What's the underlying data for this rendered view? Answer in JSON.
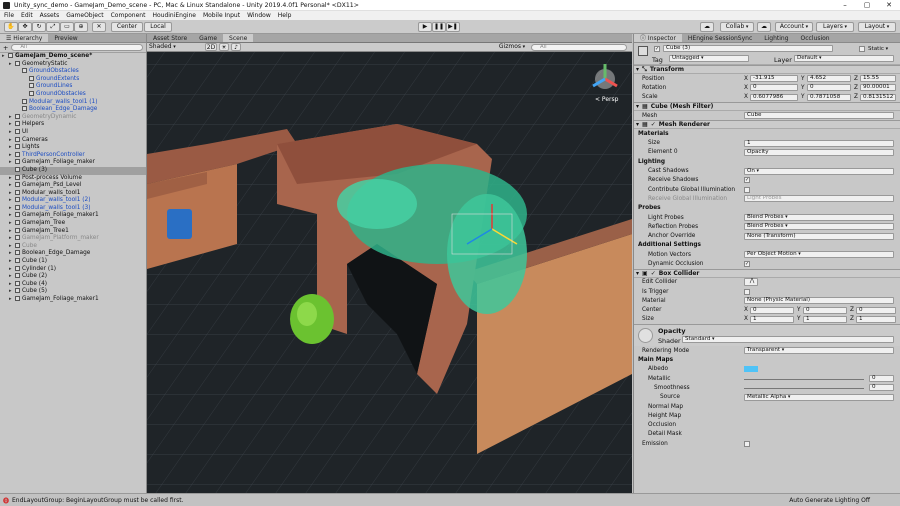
{
  "titlebar": {
    "title": "Unity_sync_demo - GameJam_Demo_scene - PC, Mac & Linux Standalone - Unity 2019.4.0f1 Personal* <DX11>",
    "minimize": "–",
    "maximize": "▢",
    "close": "✕"
  },
  "menu": [
    "File",
    "Edit",
    "Assets",
    "GameObject",
    "Component",
    "HoudiniEngine",
    "Mobile Input",
    "Window",
    "Help"
  ],
  "toolbar": {
    "center": "Center",
    "local": "Local",
    "collab": "Collab",
    "account": "Account",
    "layers": "Layers",
    "layout": "Layout"
  },
  "hierarchy": {
    "tabs": [
      "Hierarchy",
      "Preview"
    ],
    "create": "+",
    "search_placeholder": "All",
    "rows": [
      {
        "text": "GameJam_Demo_scene*",
        "depth": 0,
        "bold": true,
        "color": "",
        "sel": false
      },
      {
        "text": "GeometryStatic",
        "depth": 1,
        "color": "",
        "sel": false
      },
      {
        "text": "GroundObstacles",
        "depth": 2,
        "color": "blue",
        "sel": false
      },
      {
        "text": "GroundExtents",
        "depth": 3,
        "color": "blue",
        "sel": false
      },
      {
        "text": "GroundLines",
        "depth": 3,
        "color": "blue",
        "sel": false
      },
      {
        "text": "GroundObstacles",
        "depth": 3,
        "color": "blue",
        "sel": false
      },
      {
        "text": "Modular_walls_tool1 (1)",
        "depth": 2,
        "color": "blue",
        "sel": false
      },
      {
        "text": "Boolean_Edge_Damage",
        "depth": 2,
        "color": "blue",
        "sel": false
      },
      {
        "text": "GeometryDynamic",
        "depth": 1,
        "color": "gray",
        "sel": false
      },
      {
        "text": "Helpers",
        "depth": 1,
        "color": "",
        "sel": false
      },
      {
        "text": "UI",
        "depth": 1,
        "color": "",
        "sel": false
      },
      {
        "text": "Cameras",
        "depth": 1,
        "color": "",
        "sel": false
      },
      {
        "text": "Lights",
        "depth": 1,
        "color": "",
        "sel": false
      },
      {
        "text": "ThirdPersonController",
        "depth": 1,
        "color": "blue",
        "sel": false
      },
      {
        "text": "GameJam_Foliage_maker",
        "depth": 1,
        "color": "",
        "sel": false
      },
      {
        "text": "Cube (3)",
        "depth": 1,
        "color": "",
        "sel": true
      },
      {
        "text": "Post-process Volume",
        "depth": 1,
        "color": "",
        "sel": false
      },
      {
        "text": "GameJam_Psd_Level",
        "depth": 1,
        "color": "",
        "sel": false
      },
      {
        "text": "Modular_walls_tool1",
        "depth": 1,
        "color": "",
        "sel": false
      },
      {
        "text": "Modular_walls_tool1 (2)",
        "depth": 1,
        "color": "blue",
        "sel": false
      },
      {
        "text": "Modular_walls_tool1 (3)",
        "depth": 1,
        "color": "blue",
        "sel": false
      },
      {
        "text": "GameJam_Foliage_maker1",
        "depth": 1,
        "color": "",
        "sel": false
      },
      {
        "text": "GameJam_Tree",
        "depth": 1,
        "color": "",
        "sel": false
      },
      {
        "text": "GameJam_Tree1",
        "depth": 1,
        "color": "",
        "sel": false
      },
      {
        "text": "GameJam_Platform_maker",
        "depth": 1,
        "color": "gray",
        "sel": false
      },
      {
        "text": "Cube",
        "depth": 1,
        "color": "gray",
        "sel": false
      },
      {
        "text": "Boolean_Edge_Damage",
        "depth": 1,
        "color": "",
        "sel": false
      },
      {
        "text": "Cube (1)",
        "depth": 1,
        "color": "",
        "sel": false
      },
      {
        "text": "Cylinder (1)",
        "depth": 1,
        "color": "",
        "sel": false
      },
      {
        "text": "Cube (2)",
        "depth": 1,
        "color": "",
        "sel": false
      },
      {
        "text": "Cube (4)",
        "depth": 1,
        "color": "",
        "sel": false
      },
      {
        "text": "Cube (5)",
        "depth": 1,
        "color": "",
        "sel": false
      },
      {
        "text": "GameJam_Foliage_maker1",
        "depth": 1,
        "color": "",
        "sel": false
      }
    ]
  },
  "view": {
    "tabs": [
      "Asset Store",
      "Game",
      "Scene"
    ],
    "shading": "Shaded",
    "mode2d": "2D",
    "gizmos": "Gizmos",
    "search_placeholder": "All",
    "persp": "< Persp"
  },
  "inspector": {
    "tabs": [
      "Inspector",
      "HEngine SessionSync",
      "Lighting",
      "Occlusion"
    ],
    "object_name": "Cube (3)",
    "static": "Static",
    "tag_label": "Tag",
    "tag": "Untagged",
    "layer_label": "Layer",
    "layer": "Default",
    "transform": {
      "title": "Transform",
      "position_label": "Position",
      "rotation_label": "Rotation",
      "scale_label": "Scale",
      "position": [
        "-31.915",
        "4.652",
        "15.55"
      ],
      "rotation": [
        "0",
        "0",
        "90.00001"
      ],
      "scale": [
        "0.6077986",
        "0.7871058",
        "0.8131512"
      ]
    },
    "mesh_filter": {
      "title": "Cube (Mesh Filter)",
      "mesh_label": "Mesh",
      "mesh": "Cube"
    },
    "renderer": {
      "title": "Mesh Renderer",
      "materials": "Materials",
      "size_label": "Size",
      "size": "1",
      "element_label": "Element 0",
      "element": "Opacity",
      "lighting": "Lighting",
      "cast_label": "Cast Shadows",
      "cast": "On",
      "receive_label": "Receive Shadows",
      "contribute_label": "Contribute Global Illumination",
      "receive_gi_label": "Receive Global Illumination",
      "receive_gi": "Light Probes",
      "probes": "Probes",
      "light_probes_label": "Light Probes",
      "light_probes": "Blend Probes",
      "reflection_label": "Reflection Probes",
      "reflection": "Blend Probes",
      "anchor_label": "Anchor Override",
      "anchor": "None (Transform)",
      "additional": "Additional Settings",
      "motion_label": "Motion Vectors",
      "motion": "Per Object Motion",
      "dynamic_label": "Dynamic Occlusion"
    },
    "box": {
      "title": "Box Collider",
      "edit_label": "Edit Collider",
      "trigger_label": "Is Trigger",
      "material_label": "Material",
      "material": "None (Physic Material)",
      "center_label": "Center",
      "center": [
        "0",
        "0",
        "0"
      ],
      "size_label": "Size",
      "size": [
        "1",
        "1",
        "1"
      ]
    },
    "material": {
      "name": "Opacity",
      "shader_label": "Shader",
      "shader": "Standard",
      "render_mode_label": "Rendering Mode",
      "render_mode": "Transparent",
      "main_maps": "Main Maps",
      "albedo": "Albedo",
      "metallic": "Metallic",
      "metallic_val": "0",
      "smooth_label": "Smoothness",
      "smooth_val": "0",
      "source_label": "Source",
      "source": "Metallic Alpha",
      "normal": "Normal Map",
      "height": "Height Map",
      "occlusion": "Occlusion",
      "detail": "Detail Mask",
      "emission": "Emission",
      "albedo_color": "#4fc3f7"
    }
  },
  "status": {
    "error": "EndLayoutGroup: BeginLayoutGroup must be called first.",
    "right": "Auto Generate Lighting Off"
  }
}
